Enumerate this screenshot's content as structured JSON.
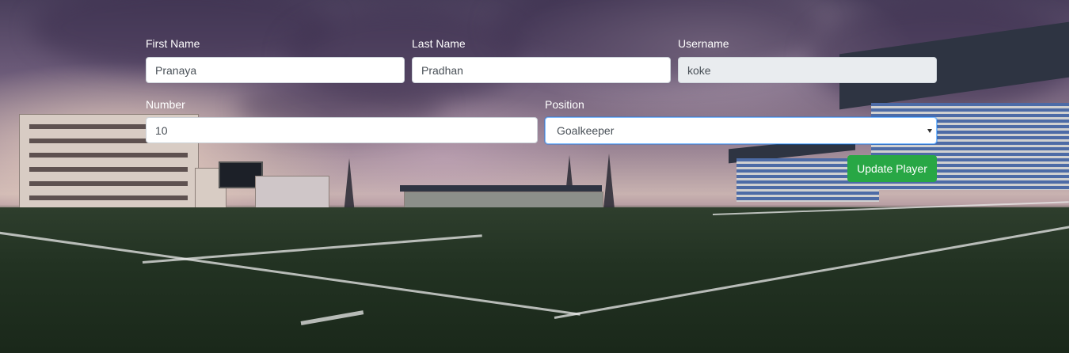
{
  "form": {
    "first_name": {
      "label": "First Name",
      "value": "Pranaya"
    },
    "last_name": {
      "label": "Last Name",
      "value": "Pradhan"
    },
    "username": {
      "label": "Username",
      "value": "koke",
      "readonly": true
    },
    "number": {
      "label": "Number",
      "value": "10"
    },
    "position": {
      "label": "Position",
      "selected": "Goalkeeper"
    },
    "submit_label": "Update Player"
  },
  "colors": {
    "button_green": "#28a745",
    "input_border": "#ced4da",
    "readonly_bg": "#e9ecef",
    "focus_border": "#80bdff"
  },
  "icons": {
    "select_caret": "chevron-down-icon"
  }
}
